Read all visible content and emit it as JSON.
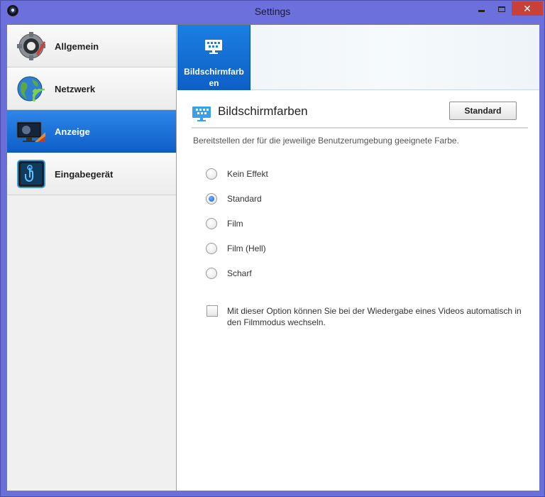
{
  "window": {
    "title": "Settings",
    "close_glyph": "✕"
  },
  "sidebar": {
    "items": [
      {
        "label": "Allgemein",
        "icon": "gear-icon",
        "active": false
      },
      {
        "label": "Netzwerk",
        "icon": "globe-wifi-icon",
        "active": false
      },
      {
        "label": "Anzeige",
        "icon": "monitor-icon",
        "active": true
      },
      {
        "label": "Eingabegerät",
        "icon": "touch-icon",
        "active": false
      }
    ]
  },
  "tab": {
    "label": "Bildschirmfarben",
    "icon": "display-colors-icon"
  },
  "section": {
    "title": "Bildschirmfarben",
    "button_label": "Standard",
    "description": "Bereitstellen der für die jeweilige Benutzerumgebung geeignete Farbe."
  },
  "options": [
    {
      "label": "Kein Effekt",
      "checked": false
    },
    {
      "label": "Standard",
      "checked": true
    },
    {
      "label": "Film",
      "checked": false
    },
    {
      "label": "Film (Hell)",
      "checked": false
    },
    {
      "label": "Scharf",
      "checked": false
    }
  ],
  "checkbox": {
    "label": "Mit dieser Option können Sie bei der Wiedergabe eines Videos automatisch in den Filmmodus wechseln.",
    "checked": false
  },
  "colors": {
    "accent": "#0d5fc6",
    "titlebar": "#6c70dc",
    "close": "#c7413a"
  }
}
